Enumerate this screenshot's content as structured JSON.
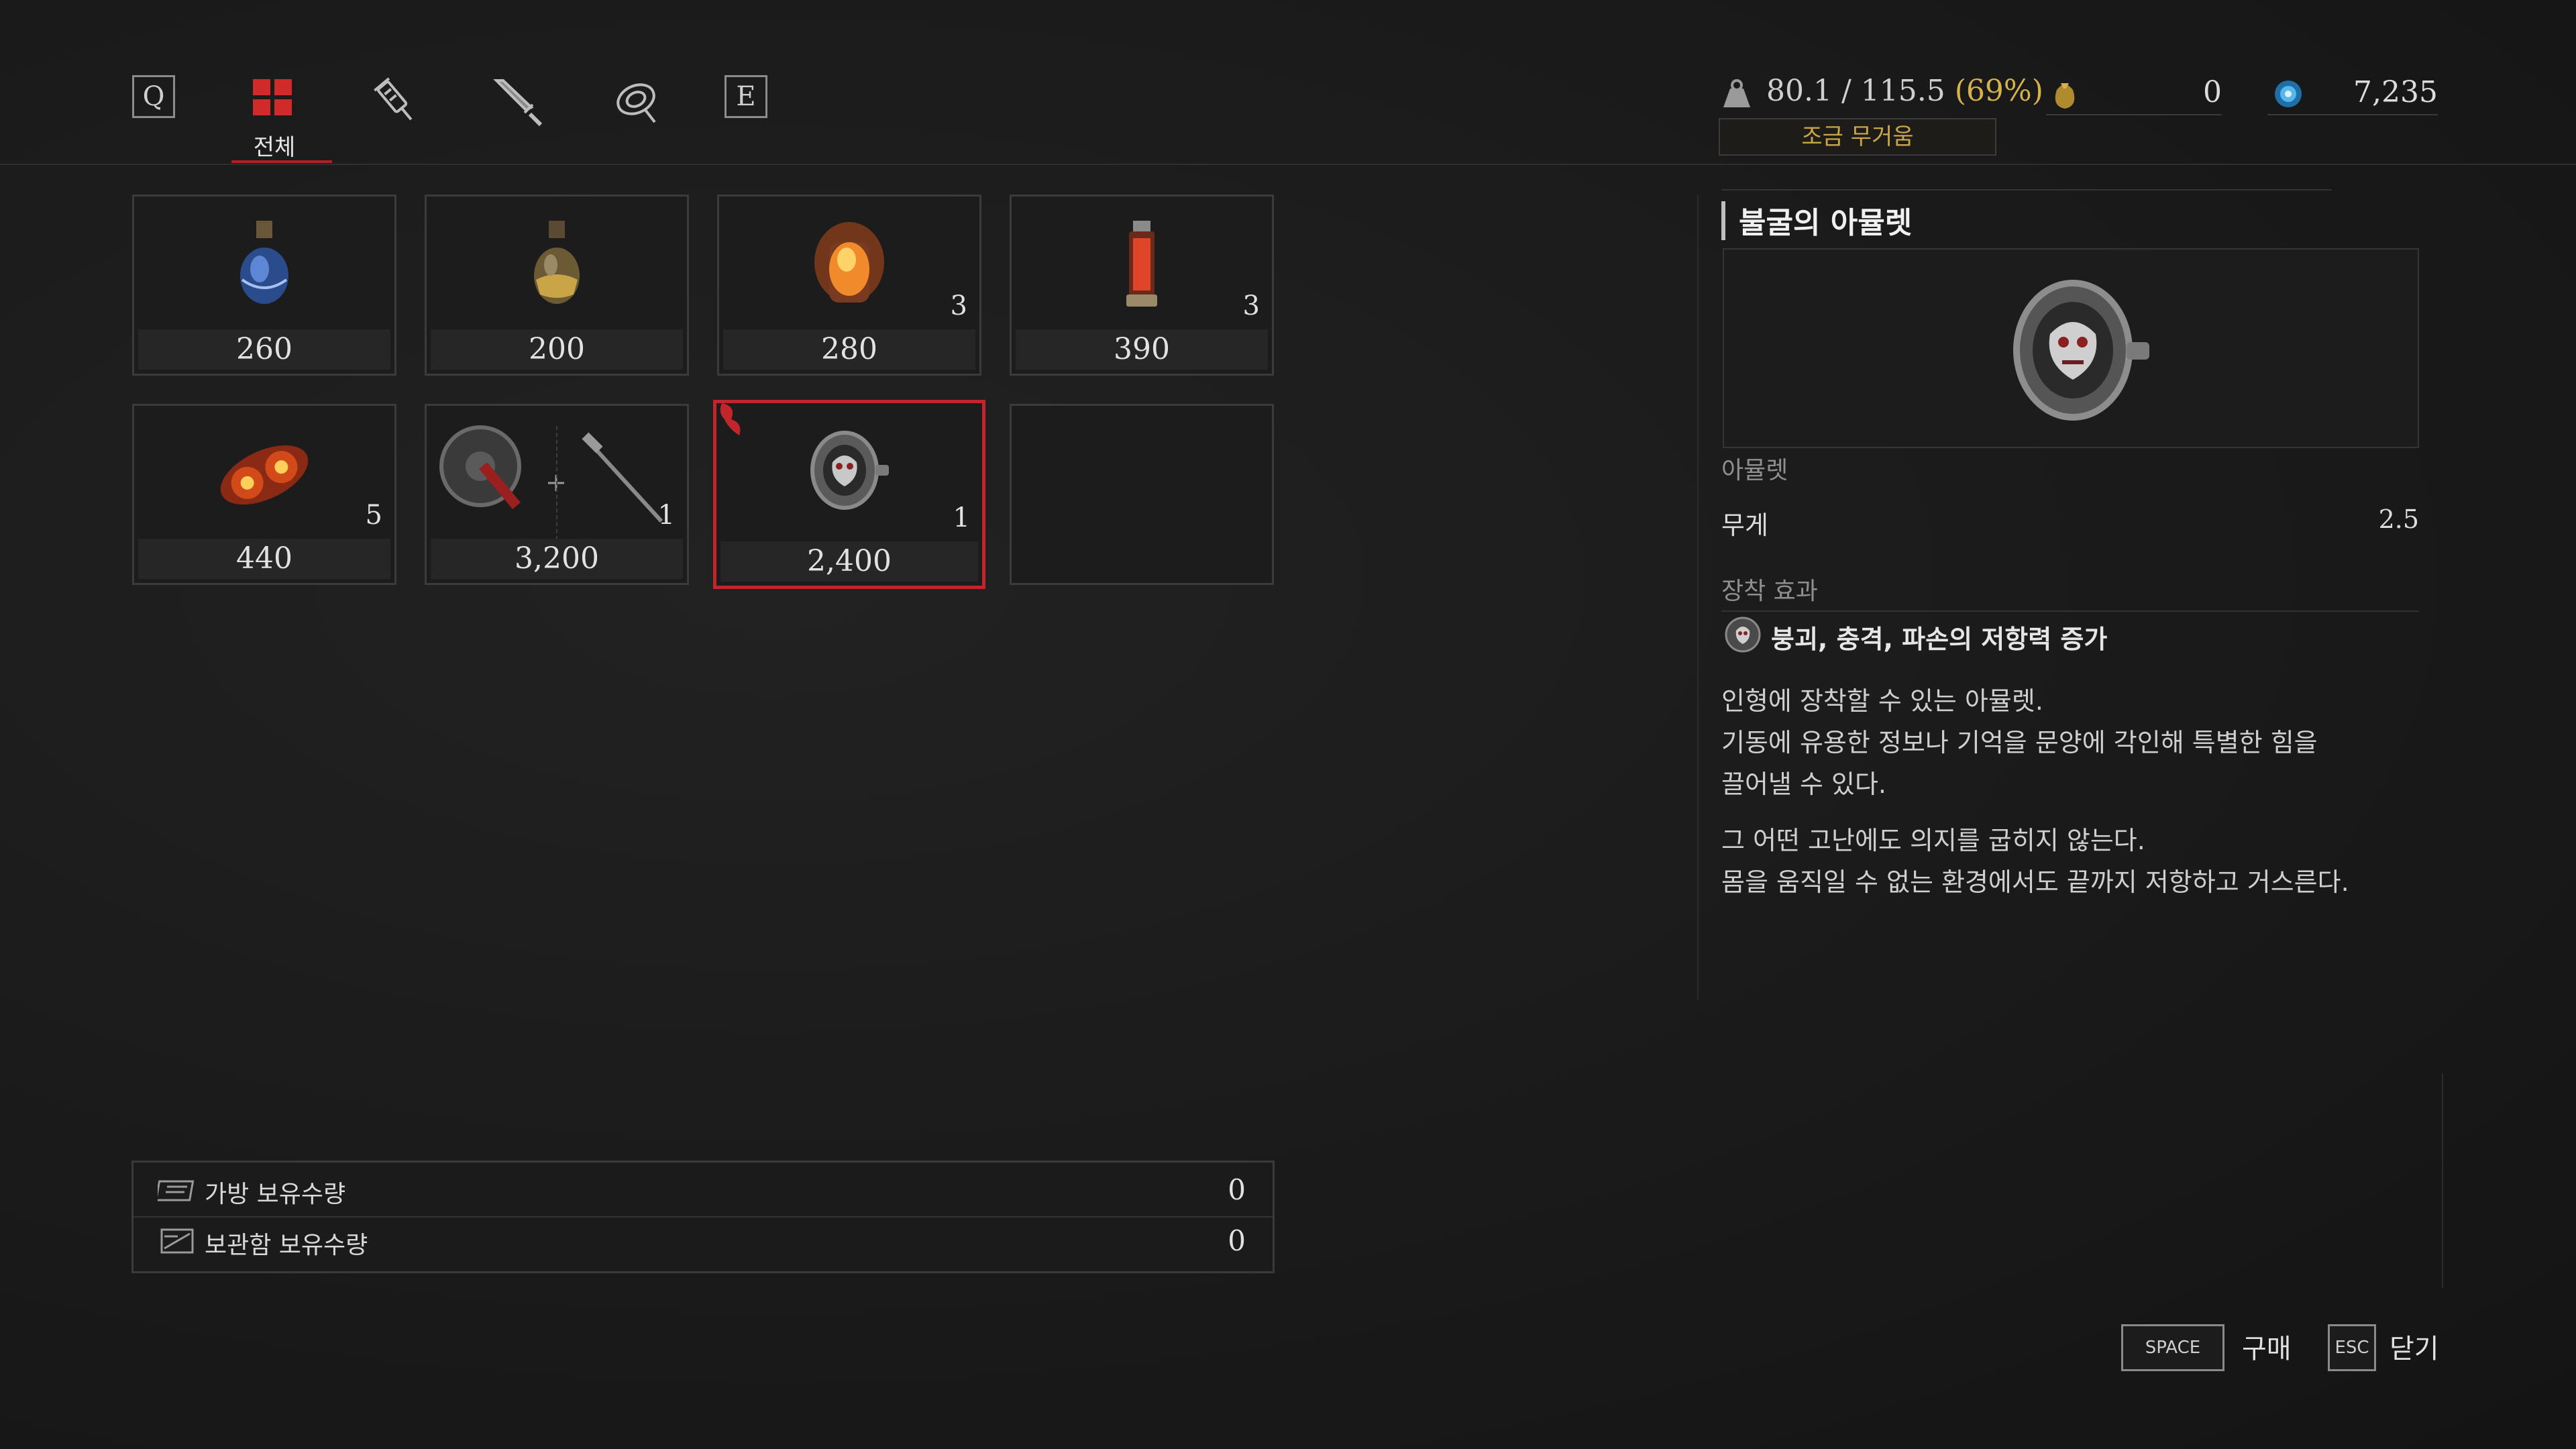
{
  "tabs": {
    "left_key": "Q",
    "right_key": "E",
    "active_label": "전체",
    "items": [
      {
        "name": "all",
        "icon": "grid-icon"
      },
      {
        "name": "consumables",
        "icon": "syringe-icon"
      },
      {
        "name": "weapons",
        "icon": "blade-icon"
      },
      {
        "name": "amulets",
        "icon": "amulet-icon"
      }
    ]
  },
  "status": {
    "weight_current": "80.1",
    "weight_max": "115.5",
    "weight_percent": "(69%)",
    "weight_state": "조금 무거움",
    "currency_1": "0",
    "currency_2": "7,235"
  },
  "items": [
    {
      "price": "260",
      "qty": "",
      "icon": "blue-potion-icon"
    },
    {
      "price": "200",
      "qty": "",
      "icon": "yellow-potion-icon"
    },
    {
      "price": "280",
      "qty": "3",
      "icon": "fire-flask-icon"
    },
    {
      "price": "390",
      "qty": "3",
      "icon": "red-canister-icon"
    },
    {
      "price": "440",
      "qty": "5",
      "icon": "fire-throwable-icon"
    },
    {
      "price": "3,200",
      "qty": "1",
      "icon": "saw-weapon-icon"
    },
    {
      "price": "2,400",
      "qty": "1",
      "icon": "amulet-icon",
      "selected": true
    },
    {
      "price": "",
      "qty": "",
      "icon": ""
    }
  ],
  "holdings": {
    "bag_label": "가방 보유수량",
    "bag_value": "0",
    "storage_label": "보관함 보유수량",
    "storage_value": "0"
  },
  "detail": {
    "title": "불굴의 아뮬렛",
    "type": "아뮬렛",
    "weight_label": "무게",
    "weight_value": "2.5",
    "effect_header": "장착 효과",
    "effect_text": "붕괴, 충격, 파손의 저항력 증가",
    "desc_lines_1": [
      "인형에 장착할 수 있는 아뮬렛.",
      "기동에 유용한 정보나 기억을 문양에 각인해 특별한 힘을",
      "끌어낼 수 있다."
    ],
    "desc_lines_2": [
      "그 어떤 고난에도 의지를 굽히지 않는다.",
      "몸을 움직일 수 없는 환경에서도 끝까지 저항하고 거스른다."
    ]
  },
  "buttons": {
    "buy_key": "SPACE",
    "buy_label": "구매",
    "close_key": "ESC",
    "close_label": "닫기"
  },
  "colors": {
    "accent_red": "#c2262b",
    "gold": "#d6b34a"
  }
}
